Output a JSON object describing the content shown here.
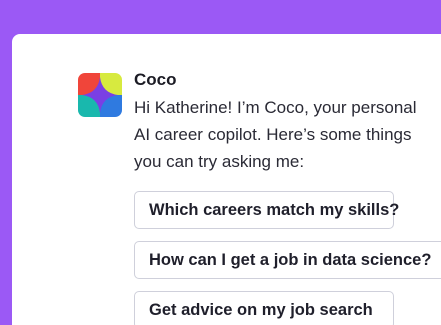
{
  "assistant": {
    "name": "Coco",
    "avatar_icon": "coco-sparkle-logo",
    "message": "Hi Katherine! I’m Coco, your personal AI career copilot. Here’s some things you can try asking me:"
  },
  "suggestions": [
    {
      "label": "Which careers match my skills?"
    },
    {
      "label": "How can I get a job in data science?"
    },
    {
      "label": "Get advice on my job search"
    }
  ],
  "colors": {
    "background": "#9b59f5",
    "panel": "#ffffff",
    "chip_border": "#cfd0db",
    "logo_red": "#f0453a",
    "logo_yellow": "#d7ea3f",
    "logo_teal": "#19b8ad",
    "logo_blue": "#2f7ae0",
    "logo_purple": "#7a3fe4"
  }
}
